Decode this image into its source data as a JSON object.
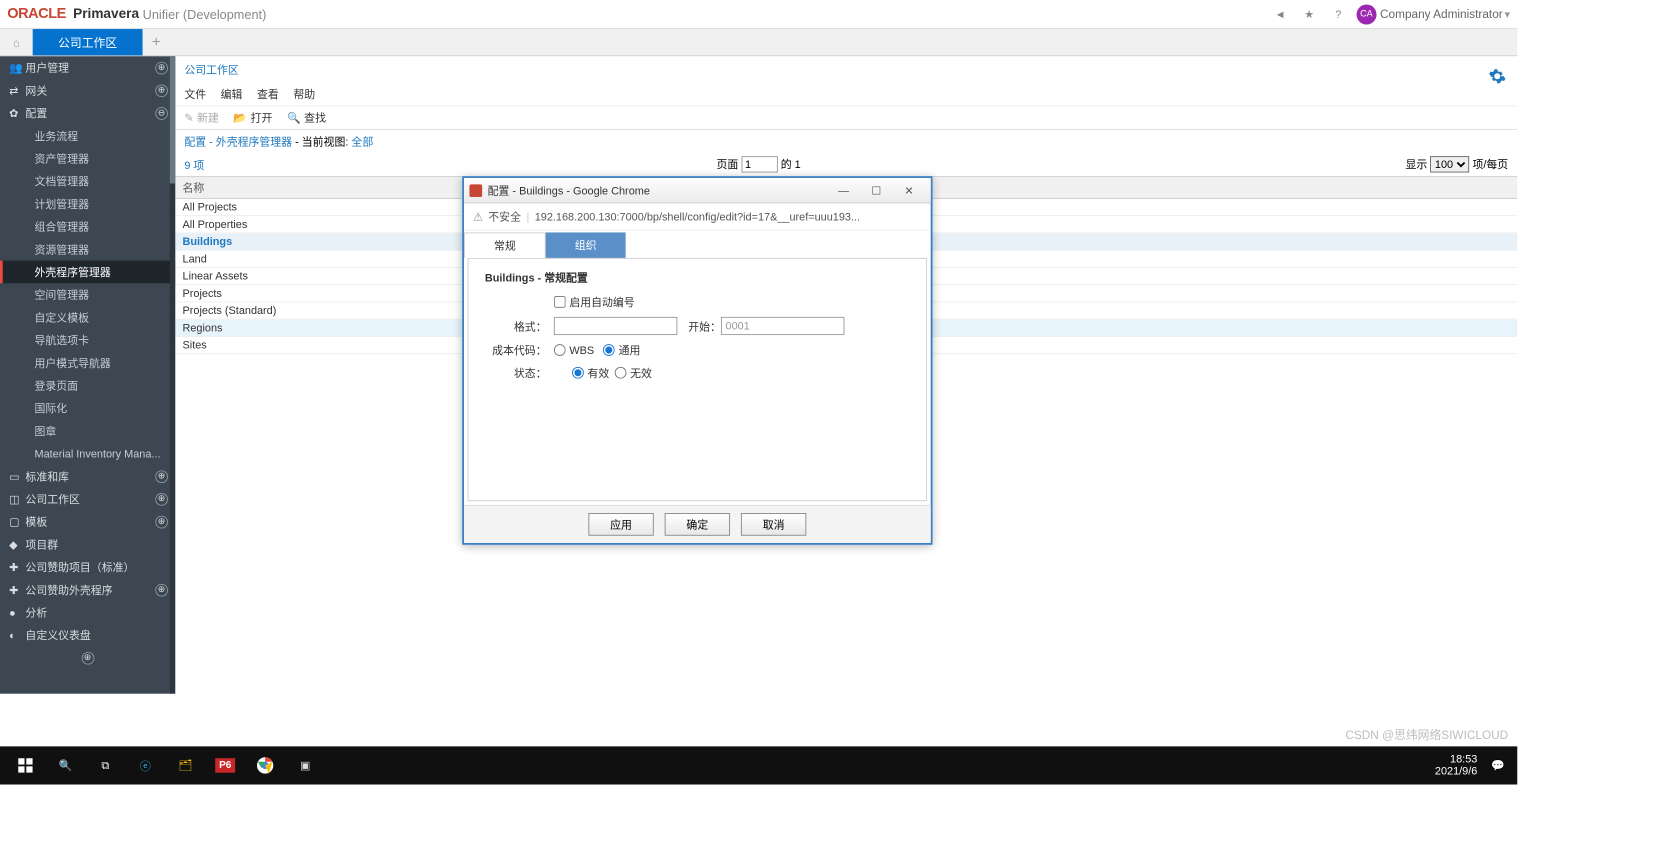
{
  "header": {
    "logo": "ORACLE",
    "product": "Primavera",
    "suffix": "Unifier  (Development)",
    "avatar": "CA",
    "user": "Company Administrator"
  },
  "tabs": {
    "home_glyph": "⌂",
    "active": "公司工作区",
    "add": "+"
  },
  "sidebar": {
    "top": [
      {
        "icon": "👥",
        "label": "用户管理",
        "exp": "⊕"
      },
      {
        "icon": "⇄",
        "label": "网关",
        "exp": "⊕"
      },
      {
        "icon": "✿",
        "label": "配置",
        "exp": "⊖"
      }
    ],
    "subs": [
      "业务流程",
      "资产管理器",
      "文档管理器",
      "计划管理器",
      "组合管理器",
      "资源管理器",
      "外壳程序管理器",
      "空间管理器",
      "自定义模板",
      "导航选项卡",
      "用户模式导航器",
      "登录页面",
      "国际化",
      "图章",
      "Material Inventory Mana..."
    ],
    "bottom": [
      {
        "icon": "▭",
        "label": "标准和库",
        "exp": "⊕"
      },
      {
        "icon": "◫",
        "label": "公司工作区",
        "exp": "⊕"
      },
      {
        "icon": "▢",
        "label": "模板",
        "exp": "⊕"
      },
      {
        "icon": "◆",
        "label": "项目群",
        "exp": ""
      },
      {
        "icon": "✚",
        "label": "公司赞助项目（标准）",
        "exp": ""
      },
      {
        "icon": "✚",
        "label": "公司赞助外壳程序",
        "exp": "⊕"
      },
      {
        "icon": "●",
        "label": "分析",
        "exp": ""
      },
      {
        "icon": "◐",
        "label": "自定义仪表盘",
        "exp": ""
      },
      {
        "icon": "",
        "label": "",
        "exp": "⊕"
      }
    ]
  },
  "main": {
    "crumb": "公司工作区",
    "menu2": [
      "文件",
      "编辑",
      "查看",
      "帮助"
    ],
    "toolbar": {
      "new": "新建",
      "open": "打开",
      "find": "查找"
    },
    "path": {
      "a": "配置 - 外壳程序管理器",
      "b": "当前视图:",
      "c": "全部"
    },
    "count": "9 项",
    "pag": {
      "page": "页面",
      "val": "1",
      "of": "的  1",
      "show": "显示",
      "per": "项/每页",
      "opt": "100"
    },
    "col": "名称",
    "rows": [
      "All Projects",
      "All Properties",
      "Buildings",
      "Land",
      "Linear Assets",
      "Projects",
      "Projects (Standard)",
      "Regions",
      "Sites"
    ]
  },
  "modal": {
    "title": "配置 - Buildings - Google Chrome",
    "insecure": "不安全",
    "url": "192.168.200.130:7000/bp/shell/config/edit?id=17&__uref=uuu193...",
    "tabs": {
      "a": "常规",
      "b": "组织"
    },
    "heading": "Buildings - 常规配置",
    "auto": "启用自动编号",
    "fmt": "格式：",
    "start": "开始：",
    "start_val": "0001",
    "cost": "成本代码：",
    "wbs": "WBS",
    "gen": "通用",
    "status": "状态：",
    "valid": "有效",
    "invalid": "无效",
    "btns": {
      "apply": "应用",
      "ok": "确定",
      "cancel": "取消"
    }
  },
  "taskbar": {
    "time": "18:53",
    "date": "2021/9/6"
  },
  "watermark": "CSDN @思纬网络SIWICLOUD"
}
